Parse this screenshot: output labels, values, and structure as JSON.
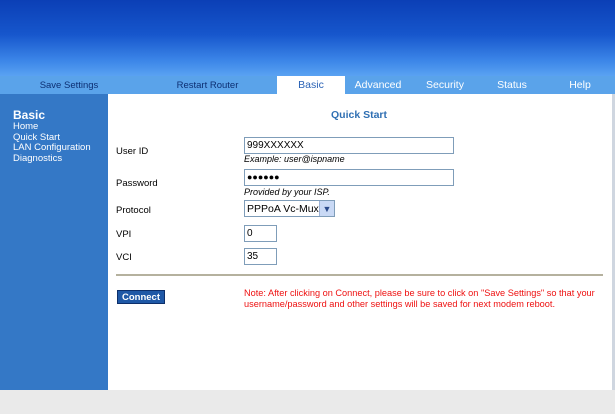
{
  "nav": {
    "utility": [
      "Save Settings",
      "Restart Router"
    ],
    "tabs": [
      "Basic",
      "Advanced",
      "Security",
      "Status",
      "Help"
    ],
    "active_tab": "Basic"
  },
  "sidebar": {
    "title": "Basic",
    "items": [
      "Home",
      "Quick Start",
      "LAN Configuration",
      "Diagnostics"
    ]
  },
  "content": {
    "heading": "Quick Start",
    "user_id": {
      "label": "User ID",
      "value": "999XXXXXX",
      "hint": "Example: user@ispname"
    },
    "password": {
      "label": "Password",
      "value": "●●●●●●",
      "hint": "Provided by your ISP."
    },
    "protocol": {
      "label": "Protocol",
      "value": "PPPoA Vc-Mux"
    },
    "vpi": {
      "label": "VPI",
      "value": "0"
    },
    "vci": {
      "label": "VCI",
      "value": "35"
    },
    "connect_label": "Connect",
    "note": "Note: After clicking on Connect, please be sure to click on \"Save Settings\" so that your username/password and other settings will be saved for next modem reboot."
  },
  "colors": {
    "nav_bg": "#5aa3ea",
    "sidebar_bg": "#3478c6",
    "heading": "#2f6fb3",
    "note": "#ee1111",
    "button": "#1f58a6"
  }
}
